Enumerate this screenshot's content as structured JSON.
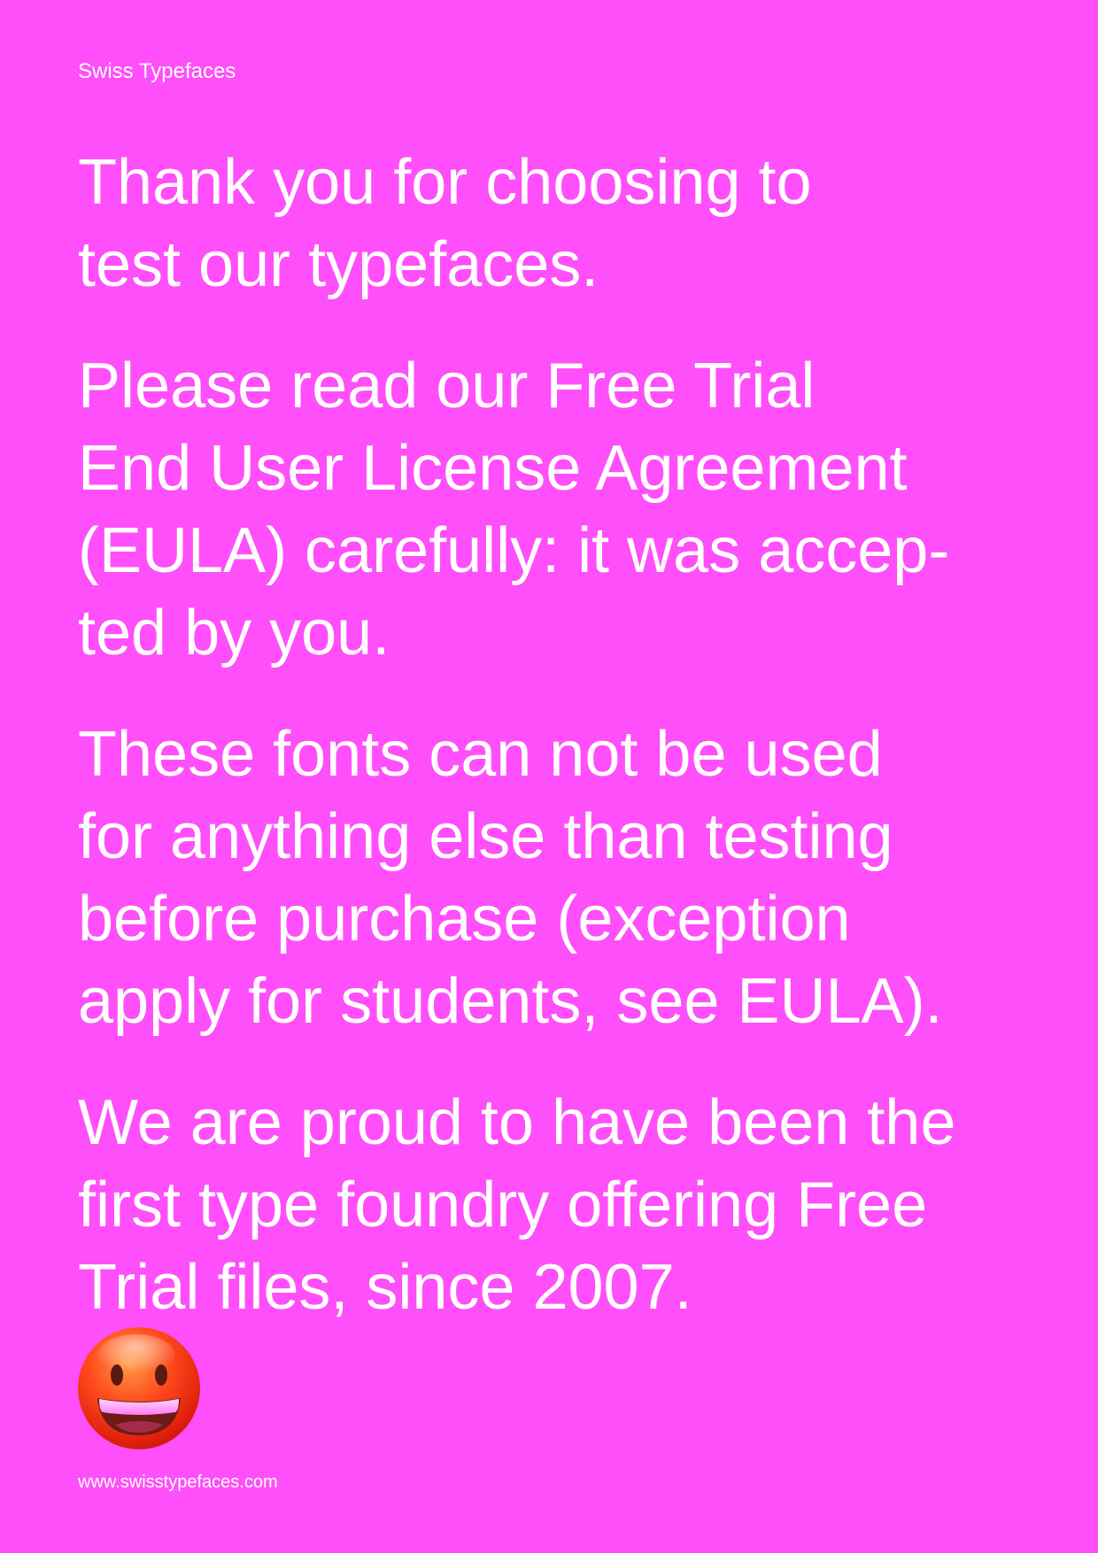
{
  "header": {
    "brand": "Swiss Typefaces"
  },
  "body": {
    "paragraphs": [
      {
        "lines": [
          "Thank you for choosing to",
          "test our typefaces."
        ]
      },
      {
        "lines": [
          "Please read our Free Trial",
          "End User License Agreement",
          "(EULA) carefully: it was accep-",
          "ted by you."
        ]
      },
      {
        "lines": [
          "These fonts can not be used",
          "for anything else than testing",
          "before purchase (exception",
          "apply for students, see EULA)."
        ]
      },
      {
        "lines": [
          "We are proud to have been the",
          "first type foundry offering Free",
          "Trial files, since 2007."
        ]
      }
    ]
  },
  "decoration": {
    "icon": "grinning-face-icon"
  },
  "footer": {
    "url": "www.swisstypefaces.com"
  },
  "colors": {
    "background": "#ff4ffa",
    "text": "#ffffff"
  }
}
